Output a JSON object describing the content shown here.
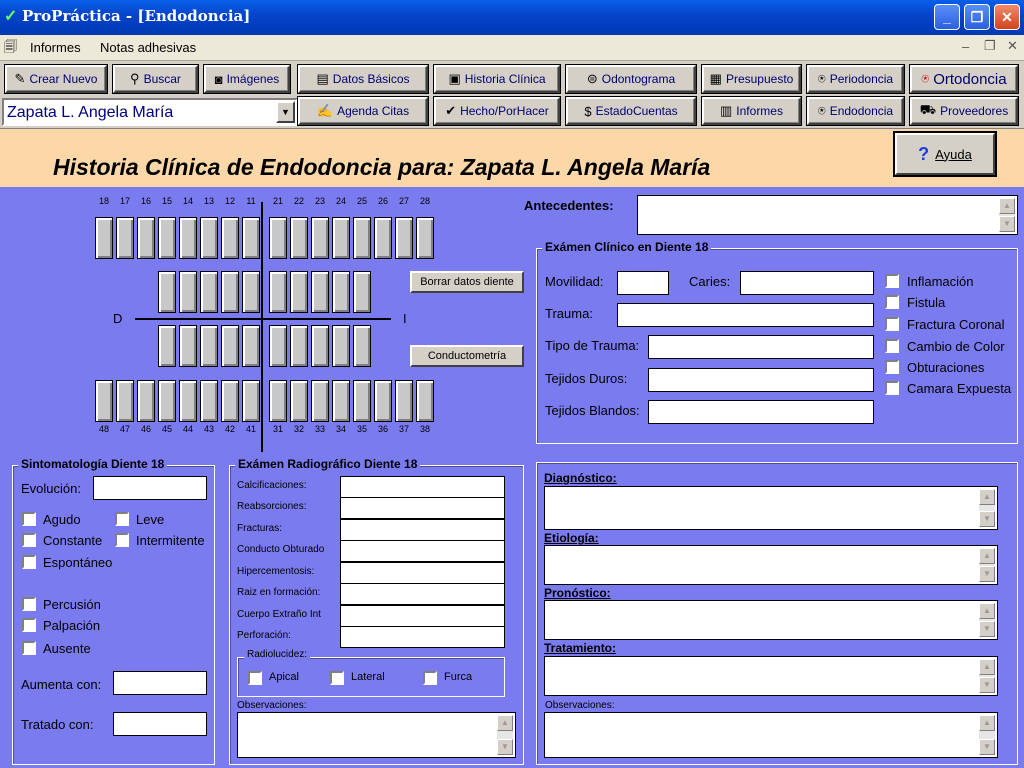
{
  "window": {
    "title": "ProPráctica - [Endodoncia]"
  },
  "menu": {
    "items": [
      "Informes",
      "Notas adhesivas"
    ]
  },
  "toolbar": {
    "crear_nuevo": "Crear Nuevo",
    "buscar": "Buscar",
    "imagenes": "Imágenes",
    "datos_basicos": "Datos Básicos",
    "historia_clinica": "Historia Clínica",
    "odontograma": "Odontograma",
    "presupuesto": "Presupuesto",
    "periodoncia": "Periodoncia",
    "ortodoncia": "Ortodoncia",
    "agenda_citas": "Agenda Citas",
    "hecho_por_hacer": "Hecho/PorHacer",
    "estado_cuentas": "EstadoCuentas",
    "informes": "Informes",
    "endodoncia": "Endodoncia",
    "proveedores": "Proveedores"
  },
  "patient": {
    "selected": "Zapata L. Angela María"
  },
  "header": {
    "title": "Historia Clínica de Endodoncia para: Zapata L. Angela María",
    "help": "Ayuda"
  },
  "teeth": {
    "upper_nums": [
      "18",
      "17",
      "16",
      "15",
      "14",
      "13",
      "12",
      "11",
      "21",
      "22",
      "23",
      "24",
      "25",
      "26",
      "27",
      "28"
    ],
    "lower_nums": [
      "48",
      "47",
      "46",
      "45",
      "44",
      "43",
      "42",
      "41",
      "31",
      "32",
      "33",
      "34",
      "35",
      "36",
      "37",
      "38"
    ],
    "label_d": "D",
    "label_i": "I",
    "borrar": "Borrar datos diente",
    "conductometria": "Conductometría"
  },
  "antecedentes": {
    "label": "Antecedentes:"
  },
  "examen_clinico": {
    "title": "Exámen Clínico en Diente 18",
    "movilidad": "Movilidad:",
    "caries": "Caries:",
    "trauma": "Trauma:",
    "tipo_trauma": "Tipo de Trauma:",
    "tejidos_duros": "Tejidos Duros:",
    "tejidos_blandos": "Tejidos Blandos:",
    "checks": [
      "Inflamación",
      "Fistula",
      "Fractura Coronal",
      "Cambio de Color",
      "Obturaciones",
      "Camara Expuesta"
    ]
  },
  "sintomatologia": {
    "title": "Sintomatología Diente 18",
    "evolucion": "Evolución:",
    "agudo": "Agudo",
    "leve": "Leve",
    "constante": "Constante",
    "intermitente": "Intermitente",
    "espontaneo": "Espontáneo",
    "percusion": "Percusión",
    "palpacion": "Palpación",
    "ausente": "Ausente",
    "aumenta": "Aumenta con:",
    "tratado": "Tratado con:"
  },
  "radiografico": {
    "title": "Exámen Radiográfico Diente 18",
    "fields": [
      "Calcificaciones:",
      "Reabsorciones:",
      "Fracturas:",
      "Conducto Obturado",
      "Hipercementosis:",
      "Raiz en formación:",
      "Cuerpo Extraño Int",
      "Perforación:"
    ],
    "radiolucidez": "Radiolucidez:",
    "apical": "Apical",
    "lateral": "Lateral",
    "furca": "Furca",
    "observaciones": "Observaciones:"
  },
  "diagnostico": {
    "diagnostico": "Diagnóstico:",
    "etiologia": "Etiología:",
    "pronostico": "Pronóstico:",
    "tratamiento": "Tratamiento:",
    "observaciones": "Observaciones:"
  }
}
